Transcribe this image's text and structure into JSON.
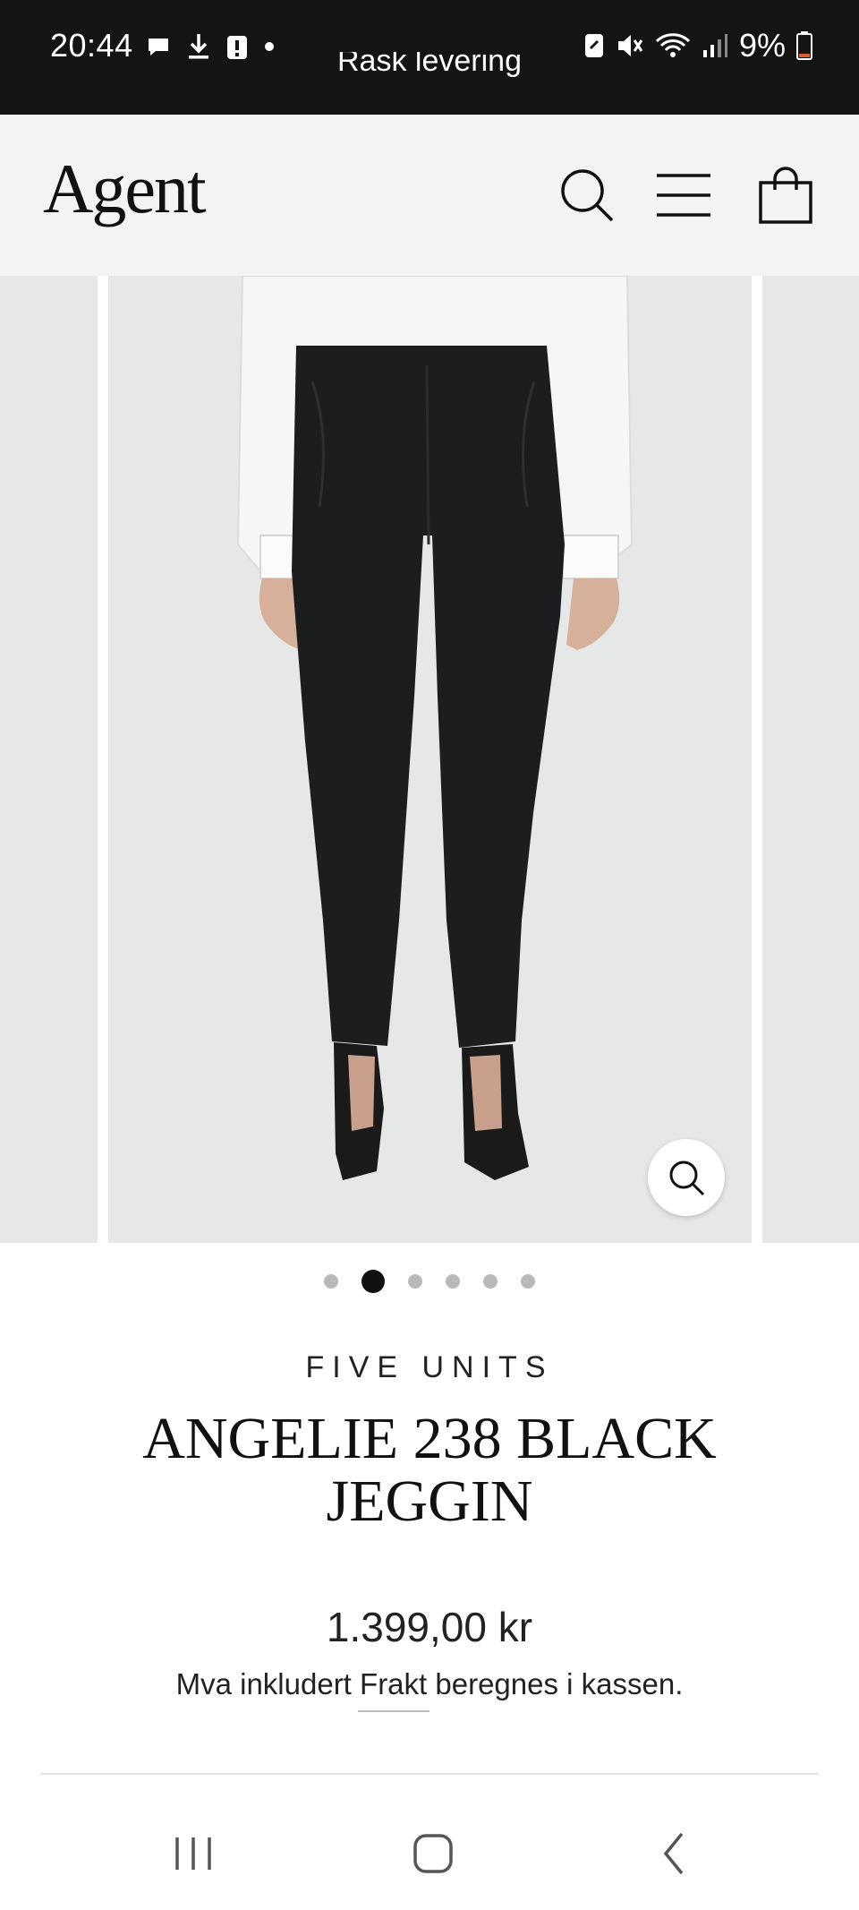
{
  "status_bar": {
    "time": "20:44",
    "battery": "9%",
    "banner_partial_text": "Rask levering",
    "left_icons": [
      "chat-bubble-icon",
      "download-icon",
      "alert-badge-icon",
      "dot-icon"
    ],
    "right_icons": [
      "nfc-icon",
      "mute-icon",
      "wifi-icon",
      "signal-icon",
      "battery-icon"
    ]
  },
  "header": {
    "logo_text": "Agent",
    "icons": [
      "search-icon",
      "menu-icon",
      "cart-icon"
    ]
  },
  "gallery": {
    "active_index": 1,
    "dot_count": 6,
    "zoom_icon": "zoom-icon"
  },
  "product": {
    "vendor": "FIVE UNITS",
    "title": "ANGELIE 238 BLACK JEGGIN",
    "price": "1.399,00 kr",
    "tax_prefix": "Mva inkludert ",
    "shipping_link": "Frakt",
    "tax_suffix": " beregnes i kassen."
  },
  "colors": {
    "status_bg": "#141414",
    "header_bg": "#f3f3f3",
    "text": "#111111",
    "pants": "#1c1d1f"
  },
  "navbar": {
    "icons": [
      "recent-apps-icon",
      "home-icon",
      "back-icon"
    ]
  }
}
